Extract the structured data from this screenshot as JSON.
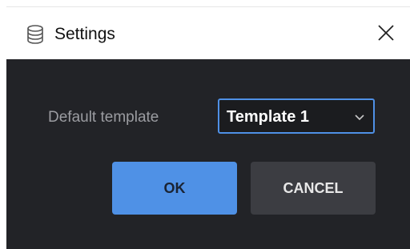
{
  "window": {
    "title": "Settings"
  },
  "form": {
    "default_template_label": "Default template",
    "default_template_value": "Template 1"
  },
  "buttons": {
    "ok_label": "OK",
    "cancel_label": "CANCEL"
  },
  "colors": {
    "background": "#222327",
    "accent": "#4f91e6",
    "secondary_button": "#3c3d42",
    "label_text": "#9b9ca1"
  },
  "icons": {
    "title": "database-icon",
    "close": "close-icon",
    "dropdown": "chevron-down-icon"
  }
}
